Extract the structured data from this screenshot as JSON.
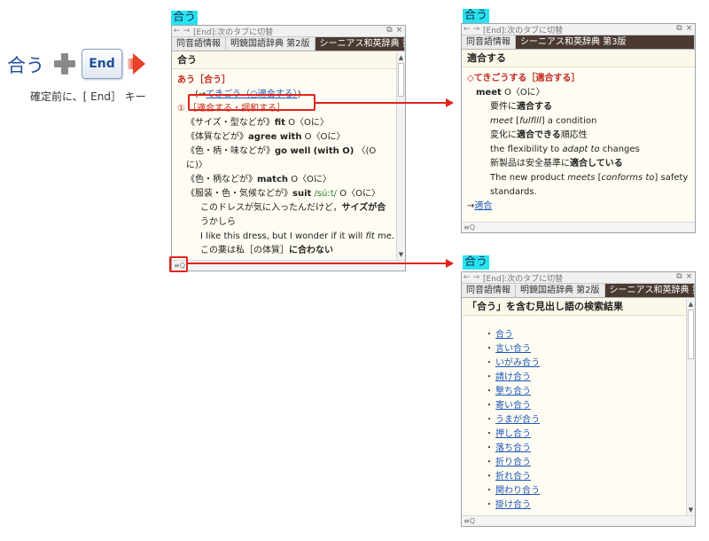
{
  "left": {
    "word": "合う",
    "key": "End",
    "caption": "確定前に、[ End］ キー"
  },
  "window_main": {
    "tag": "合う",
    "hint": "[End]:次のタブに切替",
    "tabs": [
      "同音語情報",
      "明鏡国語辞典 第2版",
      "シーニアス和英辞典 第…"
    ],
    "headword": "合う",
    "lines": {
      "l1": "あう［合う］",
      "l2_prefix": "(→",
      "l2_link": "てきごう（○適合する）",
      "l2_suffix": ")",
      "l3": "① ［適合する・調和する］",
      "l4_pre": "《サイズ・型などが》",
      "l4_en": "fit",
      "l4_post": "O〈Oに〉",
      "l5_pre": "《体質などが》",
      "l5_en": "agree with",
      "l5_post": "O〈Oに〉",
      "l6_pre": "《色・柄・味などが》",
      "l6_en": "go well",
      "l6_mid": "(with O)",
      "l6_post": "〈(O",
      "l7": "に)〉",
      "l8_pre": "《色・柄などが》",
      "l8_en": "match",
      "l8_post": "O〈Oに〉",
      "l9_pre": "《服装・色・気候などが》",
      "l9_en": "suit",
      "l9_pron": "/súːt/",
      "l9_post": "O〈Oに〉",
      "l10_pre": "このドレスが気に入ったんだけど，",
      "l10_bold": "サイズが合",
      "l11": "うかしら",
      "l12_pre": "I like this dress, but I wonder if it will ",
      "l12_it": "fit",
      "l12_post": " me.",
      "l13_pre": "この薬は私［の体質］",
      "l13_bold": "に合わない"
    }
  },
  "window_right_top": {
    "tag": "合う",
    "hint": "[End]:次のタブに切替",
    "tabs": [
      "同音語情報",
      "シーニアス和英辞典 第3版"
    ],
    "headword": "適合する",
    "lines": {
      "l1": "◇てきごうする［適合する］",
      "l2_en": "meet",
      "l2_post": " O〈Oに〉",
      "l3_pre": "要件に",
      "l3_bold": "適合する",
      "l4_it1": "meet",
      "l4_mid": " [",
      "l4_it2": "fulfill",
      "l4_post": "] a condition",
      "l5_pre": "変化に",
      "l5_bold": "適合できる",
      "l5_post": "順応性",
      "l6_pre": "the flexibility to ",
      "l6_it": "adapt to",
      "l6_post": " changes",
      "l7_pre": "新製品は安全基準に",
      "l7_bold": "適合している",
      "l8_pre": "The new product ",
      "l8_it1": "meets",
      "l8_mid": " [",
      "l8_it2": "conforms to",
      "l8_post": "] safety",
      "l9": "standards.",
      "l10_arrow": "→",
      "l10_link": "適合"
    }
  },
  "window_right_bottom": {
    "tag": "合う",
    "hint": "[End]:次のタブに切替",
    "tabs": [
      "同音語情報",
      "明鏡国語辞典 第2版",
      "シーニアス和英辞典 第…"
    ],
    "headword": "「合う」を含む見出し語の検索結果",
    "bullet": "・",
    "results": [
      "合う",
      "言い合う",
      "いがみ合う",
      "請け合う",
      "撃ち合う",
      "寄い合う",
      "うまが合う",
      "押し合う",
      "落ち合う",
      "折り合う",
      "折れ合う",
      "関わり合う",
      "掛け合う",
      "…"
    ]
  },
  "icons": {
    "back": "←",
    "forward": "→",
    "restore": "⧉",
    "close": "×",
    "scroll_up": "▲",
    "scroll_down": "▼",
    "search": "≡Q"
  }
}
